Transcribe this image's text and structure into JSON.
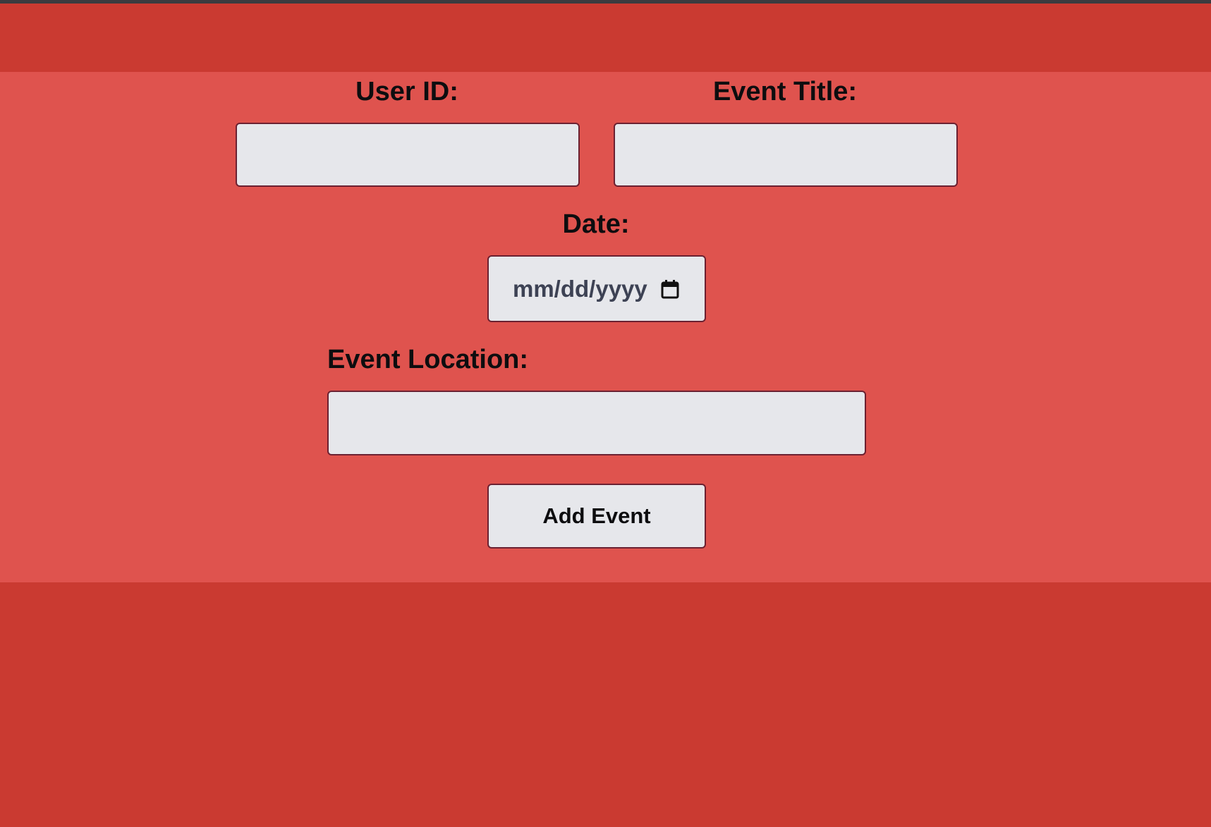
{
  "colors": {
    "page_background": "#ca3a31",
    "panel_background": "#df534e",
    "field_background": "#e6e7eb",
    "field_border": "#6b2131"
  },
  "form": {
    "user_id_label": "User ID:",
    "user_id_value": "",
    "event_title_label": "Event Title:",
    "event_title_value": "",
    "date_label": "Date:",
    "date_placeholder": "mm/dd/yyyy",
    "date_icon": "calendar-icon",
    "event_location_label": "Event Location:",
    "event_location_value": "",
    "submit_label": "Add Event"
  }
}
